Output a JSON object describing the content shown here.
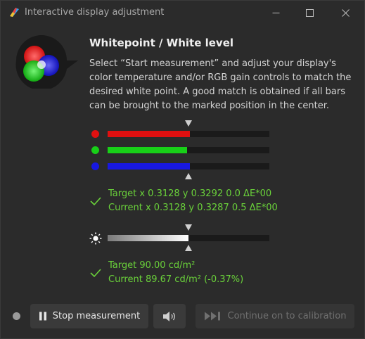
{
  "window": {
    "title": "Interactive display adjustment",
    "minimize_icon": "minimize-icon",
    "maximize_icon": "maximize-icon",
    "close_icon": "close-icon"
  },
  "header": {
    "title": "Whitepoint / White level",
    "description": "Select “Start measurement” and adjust your display's color temperature and/or RGB gain controls to match the desired white point. A good match is obtained if all bars can be brought to the marked position in the center.",
    "icon": "rgb-circles-icon"
  },
  "rgb_bars": [
    {
      "name": "red",
      "color": "#e01010",
      "level": 0.51
    },
    {
      "name": "green",
      "color": "#18d018",
      "level": 0.49
    },
    {
      "name": "blue",
      "color": "#1818e0",
      "level": 0.51
    }
  ],
  "whitepoint_status": {
    "target": "Target x 0.3128 y 0.3292 0.0 ΔE*00",
    "current": "Current x 0.3128 y 0.3287 0.5 ΔE*00"
  },
  "luminance_bar": {
    "level": 0.5,
    "icon": "brightness-icon"
  },
  "luminance_status": {
    "target": "Target 90.00 cd/m²",
    "current": "Current 89.67 cd/m² (-0.37%)"
  },
  "controls": {
    "stop_label": "Stop measurement",
    "stop_icon": "pause-icon",
    "sound_icon": "speaker-icon",
    "continue_label": "Continue on to calibration",
    "continue_icon": "skip-forward-icon"
  },
  "colors": {
    "accent_green": "#6ad23a",
    "background": "#2b2b2b"
  }
}
